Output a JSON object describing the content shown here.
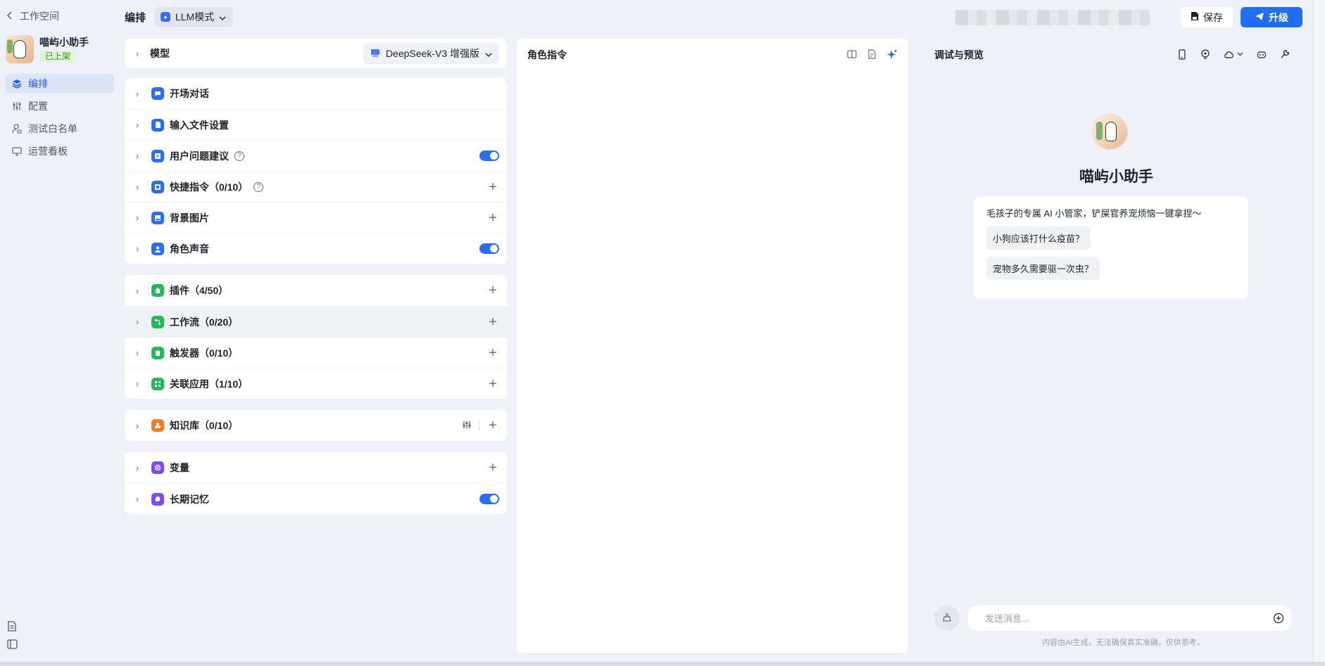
{
  "sidebar": {
    "back_label": "工作空间",
    "bot_name": "喵屿小助手",
    "bot_status": "已上架",
    "items": [
      {
        "label": "编排",
        "icon": "layers-icon",
        "active": true
      },
      {
        "label": "配置",
        "icon": "sliders-icon",
        "active": false
      },
      {
        "label": "测试白名单",
        "icon": "user-lock-icon",
        "active": false
      },
      {
        "label": "运营看板",
        "icon": "monitor-icon",
        "active": false
      }
    ],
    "bottom_icons": [
      "document-icon",
      "panel-toggle-icon"
    ]
  },
  "header": {
    "title": "编排",
    "mode_label": "LLM模式",
    "save_label": "保存",
    "upgrade_label": "升级"
  },
  "config": {
    "model": {
      "label": "模型",
      "value": "DeepSeek-V3 增强版"
    },
    "dialog_group": [
      {
        "label": "开场对话",
        "icon": "chat-bubble-icon",
        "color": "#2e6cf0",
        "action": "none"
      },
      {
        "label": "输入文件设置",
        "icon": "file-icon",
        "color": "#2e6cf0",
        "action": "none"
      },
      {
        "label": "用户问题建议",
        "icon": "suggestion-icon",
        "color": "#2e6cf0",
        "action": "toggle",
        "help": true,
        "enabled": true
      },
      {
        "label": "快捷指令（0/10）",
        "icon": "shortcut-icon",
        "color": "#2e6cf0",
        "action": "plus",
        "help": true
      },
      {
        "label": "背景图片",
        "icon": "image-icon",
        "color": "#2e6cf0",
        "action": "plus"
      },
      {
        "label": "角色声音",
        "icon": "voice-icon",
        "color": "#2e6cf0",
        "action": "toggle",
        "enabled": true
      }
    ],
    "skills_group": [
      {
        "label": "插件（4/50）",
        "icon": "plugin-icon",
        "color": "#23b85a",
        "action": "plus"
      },
      {
        "label": "工作流（0/20）",
        "icon": "workflow-icon",
        "color": "#23b85a",
        "action": "plus",
        "highlight": true
      },
      {
        "label": "触发器（0/10）",
        "icon": "trigger-icon",
        "color": "#23b85a",
        "action": "plus"
      },
      {
        "label": "关联应用（1/10）",
        "icon": "apps-icon",
        "color": "#23b85a",
        "action": "plus"
      }
    ],
    "knowledge_group": [
      {
        "label": "知识库（0/10）",
        "icon": "knowledge-icon",
        "color": "#f5792a",
        "action": "plus",
        "settings": true
      }
    ],
    "memory_group": [
      {
        "label": "变量",
        "icon": "variable-icon",
        "color": "#7b4cf0",
        "action": "plus"
      },
      {
        "label": "长期记忆",
        "icon": "memory-icon",
        "color": "#7b4cf0",
        "action": "toggle",
        "enabled": true
      }
    ]
  },
  "prompt": {
    "title": "角色指令",
    "tools": [
      "compare-icon",
      "format-icon",
      "ai-sparkle-icon"
    ]
  },
  "preview": {
    "title": "调试与预览",
    "tools": [
      "phone-icon",
      "voice-setting-icon",
      "cloud-icon",
      "chevron-down-icon",
      "bot-icon",
      "wrench-icon"
    ],
    "bot_name": "喵屿小助手",
    "intro": "毛孩子的专属 AI 小管家，铲屎官养宠烦恼一键拿捏～",
    "suggestions": [
      "小狗应该打什么疫苗？",
      "宠物多久需要驱一次虫？"
    ],
    "input_placeholder": "发送消息...",
    "disclaimer": "内容由AI生成，无法确保真实准确，仅供参考。"
  },
  "colors": {
    "accent": "#1f6ff0",
    "background": "#eff1f8",
    "dialog_icon": "#2e6cf0",
    "skill_icon": "#23b85a",
    "knowledge_icon": "#f5792a",
    "memory_icon": "#7b4cf0"
  }
}
